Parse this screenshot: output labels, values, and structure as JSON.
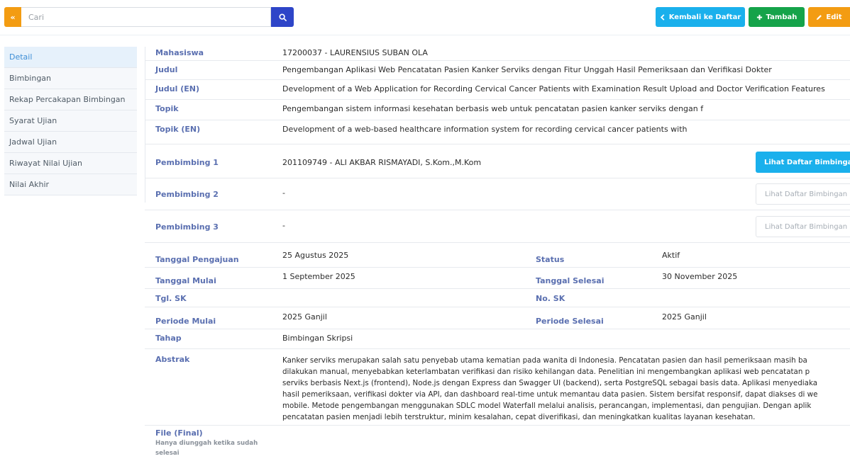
{
  "toolbar": {
    "collapse_icon": "«",
    "search_placeholder": "Cari",
    "back_label": "Kembali ke Daftar",
    "add_label": "Tambah",
    "edit_label": "Edit"
  },
  "sidebar": {
    "items": [
      {
        "label": "Detail",
        "active": true
      },
      {
        "label": "Bimbingan"
      },
      {
        "label": "Rekap Percakapan Bimbingan"
      },
      {
        "label": "Syarat Ujian"
      },
      {
        "label": "Jadwal Ujian"
      },
      {
        "label": "Riwayat Nilai Ujian"
      },
      {
        "label": "Nilai Akhir"
      }
    ]
  },
  "detail": {
    "mahasiswa": {
      "label": "Mahasiswa",
      "value": "17200037 - LAURENSIUS SUBAN OLA"
    },
    "judul": {
      "label": "Judul",
      "value": "Pengembangan Aplikasi Web Pencatatan Pasien Kanker Serviks dengan Fitur Unggah Hasil Pemeriksaan dan Verifikasi Dokter"
    },
    "judul_en": {
      "label": "Judul (EN)",
      "value": "Development of a Web Application for Recording Cervical Cancer Patients with Examination Result Upload and Doctor Verification Features"
    },
    "topik": {
      "label": "Topik",
      "value": "Pengembangan sistem informasi kesehatan berbasis web untuk pencatatan pasien kanker serviks dengan f"
    },
    "topik_en": {
      "label": "Topik (EN)",
      "value": "Development of a web-based healthcare information system for recording cervical cancer patients with"
    },
    "pembimbing1": {
      "label": "Pembimbing 1",
      "value": "201109749 - ALI AKBAR RISMAYADI, S.Kom.,M.Kom",
      "button": "Lihat Daftar Bimbingan"
    },
    "pembimbing2": {
      "label": "Pembimbing 2",
      "value": "-",
      "button": "Lihat Daftar Bimbingan"
    },
    "pembimbing3": {
      "label": "Pembimbing 3",
      "value": "-",
      "button": "Lihat Daftar Bimbingan"
    },
    "tanggal_pengajuan": {
      "label": "Tanggal Pengajuan",
      "value": "25 Agustus 2025"
    },
    "status": {
      "label": "Status",
      "value": "Aktif"
    },
    "tanggal_mulai": {
      "label": "Tanggal Mulai",
      "value": "1 September 2025"
    },
    "tanggal_selesai": {
      "label": "Tanggal Selesai",
      "value": "30 November 2025"
    },
    "tgl_sk": {
      "label": "Tgl. SK",
      "value": ""
    },
    "no_sk": {
      "label": "No. SK",
      "value": ""
    },
    "periode_mulai": {
      "label": "Periode Mulai",
      "value": "2025 Ganjil"
    },
    "periode_selesai": {
      "label": "Periode Selesai",
      "value": "2025 Ganjil"
    },
    "tahap": {
      "label": "Tahap",
      "value": "Bimbingan Skripsi"
    },
    "abstrak": {
      "label": "Abstrak",
      "lines": [
        "Kanker serviks merupakan salah satu penyebab utama kematian pada wanita di Indonesia. Pencatatan pasien dan hasil pemeriksaan masih ba",
        "dilakukan manual, menyebabkan keterlambatan verifikasi dan risiko kehilangan data. Penelitian ini mengembangkan aplikasi web pencatatan p",
        "serviks berbasis Next.js (frontend), Node.js dengan Express dan Swagger UI (backend), serta PostgreSQL sebagai basis data. Aplikasi menyediaka",
        "hasil pemeriksaan, verifikasi dokter via API, dan dashboard real-time untuk memantau data pasien. Sistem bersifat responsif, dapat diakses di we",
        "mobile. Metode pengembangan menggunakan SDLC model Waterfall melalui analisis, perancangan, implementasi, dan pengujian. Dengan aplik",
        "pencatatan pasien menjadi lebih terstruktur, minim kesalahan, cepat diverifikasi, dan meningkatkan kualitas layanan kesehatan."
      ]
    },
    "file_final": {
      "label": "File (Final)",
      "note": "Hanya diunggah ketika sudah selesai"
    }
  }
}
